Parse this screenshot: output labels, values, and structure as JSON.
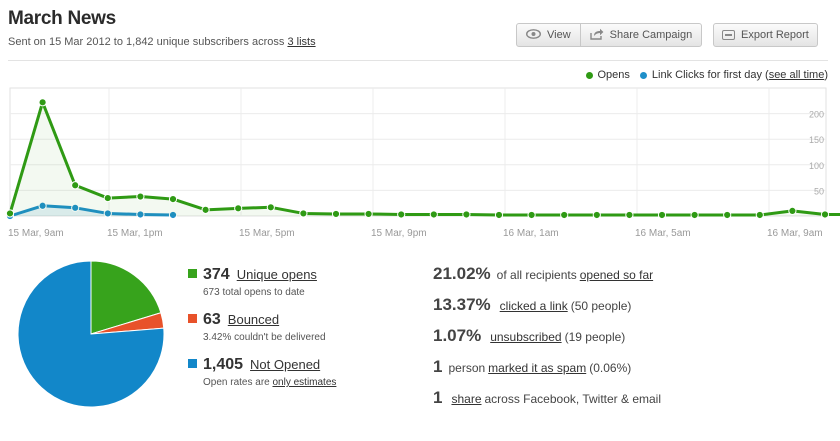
{
  "header": {
    "title": "March News",
    "sent_prefix": "Sent on 15 Mar 2012 to 1,842 unique subscribers across ",
    "lists_link": "3 lists"
  },
  "toolbar": {
    "view_label": "View",
    "share_label": "Share Campaign",
    "export_label": "Export Report"
  },
  "legend": {
    "opens_label": "Opens",
    "clicks_label": "Link Clicks for first day",
    "see_all_open": "(",
    "see_all_link": "see all time",
    "see_all_close": ")"
  },
  "colors": {
    "opens": "#2f9a14",
    "clicks": "#1e8fc9",
    "bounced": "#e8522a",
    "not_opened": "#1287c9",
    "unique_opens": "#37a31c"
  },
  "chart_data": {
    "type": "line",
    "x_tick_labels": [
      "15 Mar, 9am",
      "15 Mar, 1pm",
      "15 Mar, 5pm",
      "15 Mar, 9pm",
      "16 Mar, 1am",
      "16 Mar, 5am",
      "16 Mar, 9am"
    ],
    "y_tick_labels": [
      "200",
      "150",
      "100",
      "50"
    ],
    "ylim": [
      0,
      250
    ],
    "grid": true,
    "legend_position": "top-right",
    "series": [
      {
        "name": "Opens",
        "values": [
          5,
          222,
          60,
          35,
          38,
          33,
          12,
          15,
          17,
          5,
          4,
          4,
          3,
          3,
          3,
          2,
          2,
          2,
          2,
          2,
          2,
          2,
          2,
          2,
          10,
          3,
          3
        ]
      },
      {
        "name": "Link Clicks for first day",
        "values": [
          0,
          20,
          16,
          5,
          3,
          2
        ]
      }
    ]
  },
  "pie": {
    "segments": [
      {
        "name": "Unique opens",
        "value": 374
      },
      {
        "name": "Bounced",
        "value": 63
      },
      {
        "name": "Not Opened",
        "value": 1405
      }
    ]
  },
  "stats": {
    "unique_opens": {
      "num": "374",
      "label": "Unique opens",
      "sub": "673 total opens to date"
    },
    "bounced": {
      "num": "63",
      "label": "Bounced",
      "sub": "3.42% couldn't be delivered"
    },
    "not_opened": {
      "num": "1,405",
      "label": "Not Opened",
      "sub_prefix": "Open rates are ",
      "sub_link": "only estimates"
    }
  },
  "metrics": {
    "opened": {
      "big": "21.02%",
      "text": "of all recipients",
      "link": "opened so far"
    },
    "clicked": {
      "big": "13.37%",
      "link": "clicked a link",
      "text": "(50 people)"
    },
    "unsub": {
      "big": "1.07%",
      "link": "unsubscribed",
      "text": "(19 people)"
    },
    "spam": {
      "big": "1",
      "pre": "person",
      "link": "marked it as spam",
      "text": "(0.06%)"
    },
    "share": {
      "big": "1",
      "link": "share",
      "text": "across Facebook, Twitter & email"
    }
  }
}
